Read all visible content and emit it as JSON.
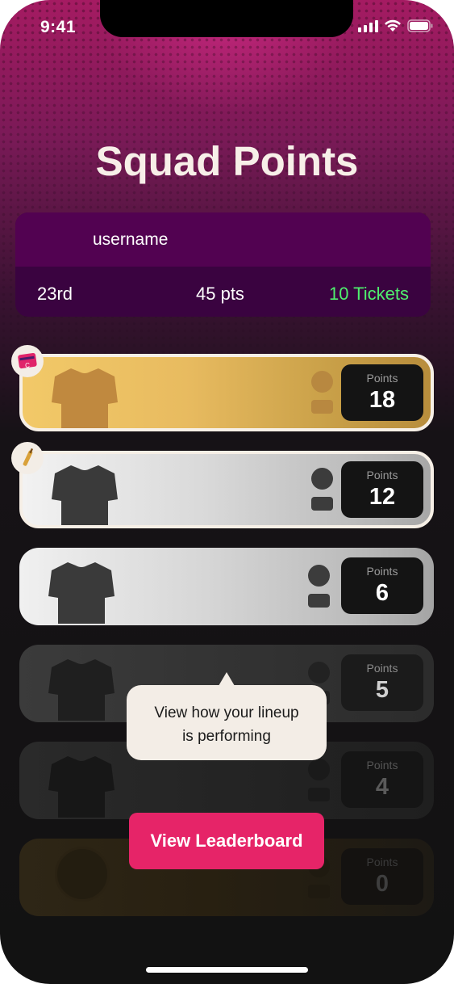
{
  "status_bar": {
    "time": "9:41"
  },
  "header": {
    "title": "Squad Points"
  },
  "summary": {
    "username": "username",
    "rank": "23rd",
    "points": "45 pts",
    "tickets": "10 Tickets",
    "tickets_color": "#4ff06e"
  },
  "players": [
    {
      "points_label": "Points",
      "points": "18",
      "tier": "gold",
      "badge": "captain-card-icon"
    },
    {
      "points_label": "Points",
      "points": "12",
      "tier": "silver",
      "badge": "cricket-bat-icon"
    },
    {
      "points_label": "Points",
      "points": "6",
      "tier": "silver"
    },
    {
      "points_label": "Points",
      "points": "5",
      "tier": "dim"
    },
    {
      "points_label": "Points",
      "points": "4",
      "tier": "dim"
    },
    {
      "points_label": "Points",
      "points": "0",
      "tier": "dim-gold"
    }
  ],
  "tooltip": {
    "line1": "View how your lineup",
    "line2": "is performing"
  },
  "actions": {
    "leaderboard_label": "View Leaderboard"
  },
  "colors": {
    "accent": "#e62468",
    "brand_purple": "#520251"
  }
}
